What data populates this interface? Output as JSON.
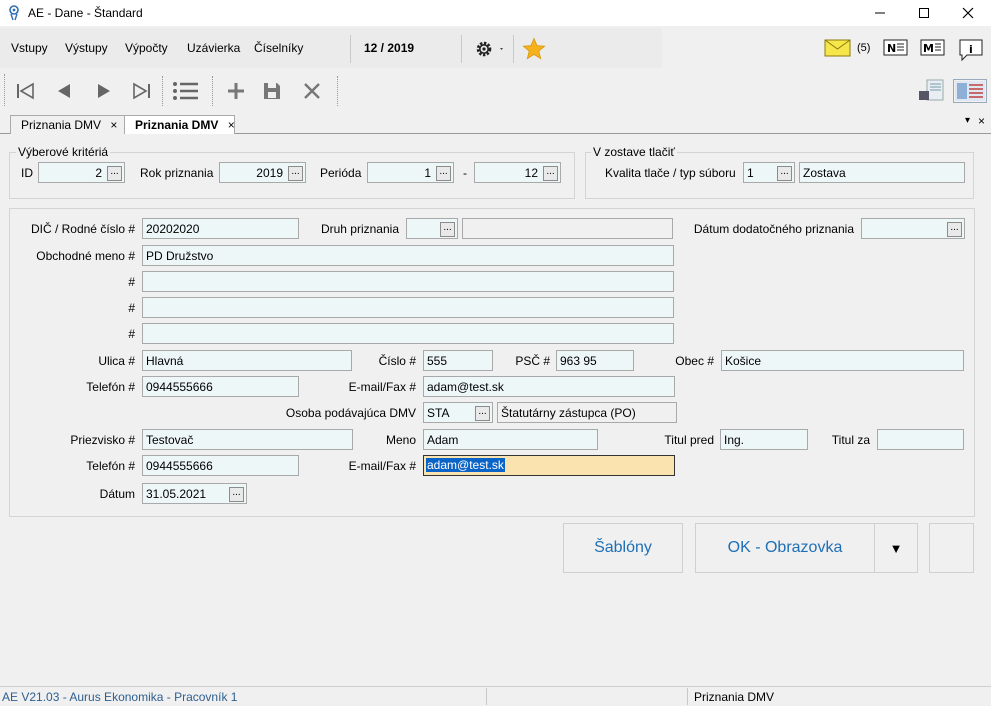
{
  "window": {
    "title": "AE - Dane - Štandard",
    "minimize_icon": "minimize-icon",
    "maximize_icon": "maximize-icon",
    "close_icon": "close-icon"
  },
  "menu": {
    "items": [
      "Vstupy",
      "Výstupy",
      "Výpočty",
      "Uzávierka",
      "Číselníky"
    ],
    "period": "12 / 2019",
    "mail_count": "(5)"
  },
  "tabs": [
    {
      "label": "Priznania DMV",
      "close": "×",
      "active": false
    },
    {
      "label": "Priznania DMV",
      "close": "×",
      "active": true
    }
  ],
  "tabstrip_menu_glyph": "▾",
  "tabstrip_close_glyph": "×",
  "criteria": {
    "title": "Výberové kritériá",
    "id_label": "ID",
    "id_value": "2",
    "year_label": "Rok priznania",
    "year_value": "2019",
    "period_label": "Perióda",
    "period_from": "1",
    "period_dash": "-",
    "period_to": "12"
  },
  "print": {
    "title": "V zostave tlačiť",
    "quality_label": "Kvalita tlače / typ súboru",
    "quality_value": "1",
    "quality_name": "Zostava"
  },
  "dots": "...",
  "form": {
    "dic_label": "DIČ / Rodné číslo #",
    "dic_value": "20202020",
    "type_label": "Druh priznania",
    "type_value": "",
    "type_name": "",
    "addl_date_label": "Dátum dodatočného priznania",
    "addl_date_value": "",
    "name_label": "Obchodné meno #",
    "name_value": "PD Družstvo",
    "hash": "#",
    "name2": "",
    "name3": "",
    "name4": "",
    "street_label": "Ulica #",
    "street_value": "Hlavná",
    "number_label": "Číslo #",
    "number_value": "555",
    "zip_label": "PSČ #",
    "zip_value": "963 95",
    "city_label": "Obec #",
    "city_value": "Košice",
    "phone_label": "Telefón #",
    "phone_value": "0944555666",
    "email_label": "E-mail/Fax #",
    "email_value": "adam@test.sk",
    "filer_label": "Osoba podávajúca DMV",
    "filer_code": "STA",
    "filer_name": "Štatutárny zástupca (PO)",
    "surname_label": "Priezvisko #",
    "surname_value": "Testovač",
    "firstname_label": "Meno",
    "firstname_value": "Adam",
    "title_before_label": "Titul pred",
    "title_before_value": "Ing.",
    "title_after_label": "Titul za",
    "title_after_value": "",
    "phone2_label": "Telefón #",
    "phone2_value": "0944555666",
    "email2_label": "E-mail/Fax #",
    "email2_value": "adam@test.sk",
    "date_label": "Dátum",
    "date_value": "31.05.2021"
  },
  "buttons": {
    "templates": "Šablóny",
    "ok_screen": "OK - Obrazovka",
    "dropdown_glyph": "▼"
  },
  "status": {
    "left": "AE V21.03 - Aurus Ekonomika - Pracovník 1",
    "right": "Priznania DMV"
  },
  "colors": {
    "accent_blue": "#1e6fb5",
    "field_bg": "#eef7f8",
    "focused_field_bg": "#fbe3b0",
    "selection": "#0a64c8"
  }
}
